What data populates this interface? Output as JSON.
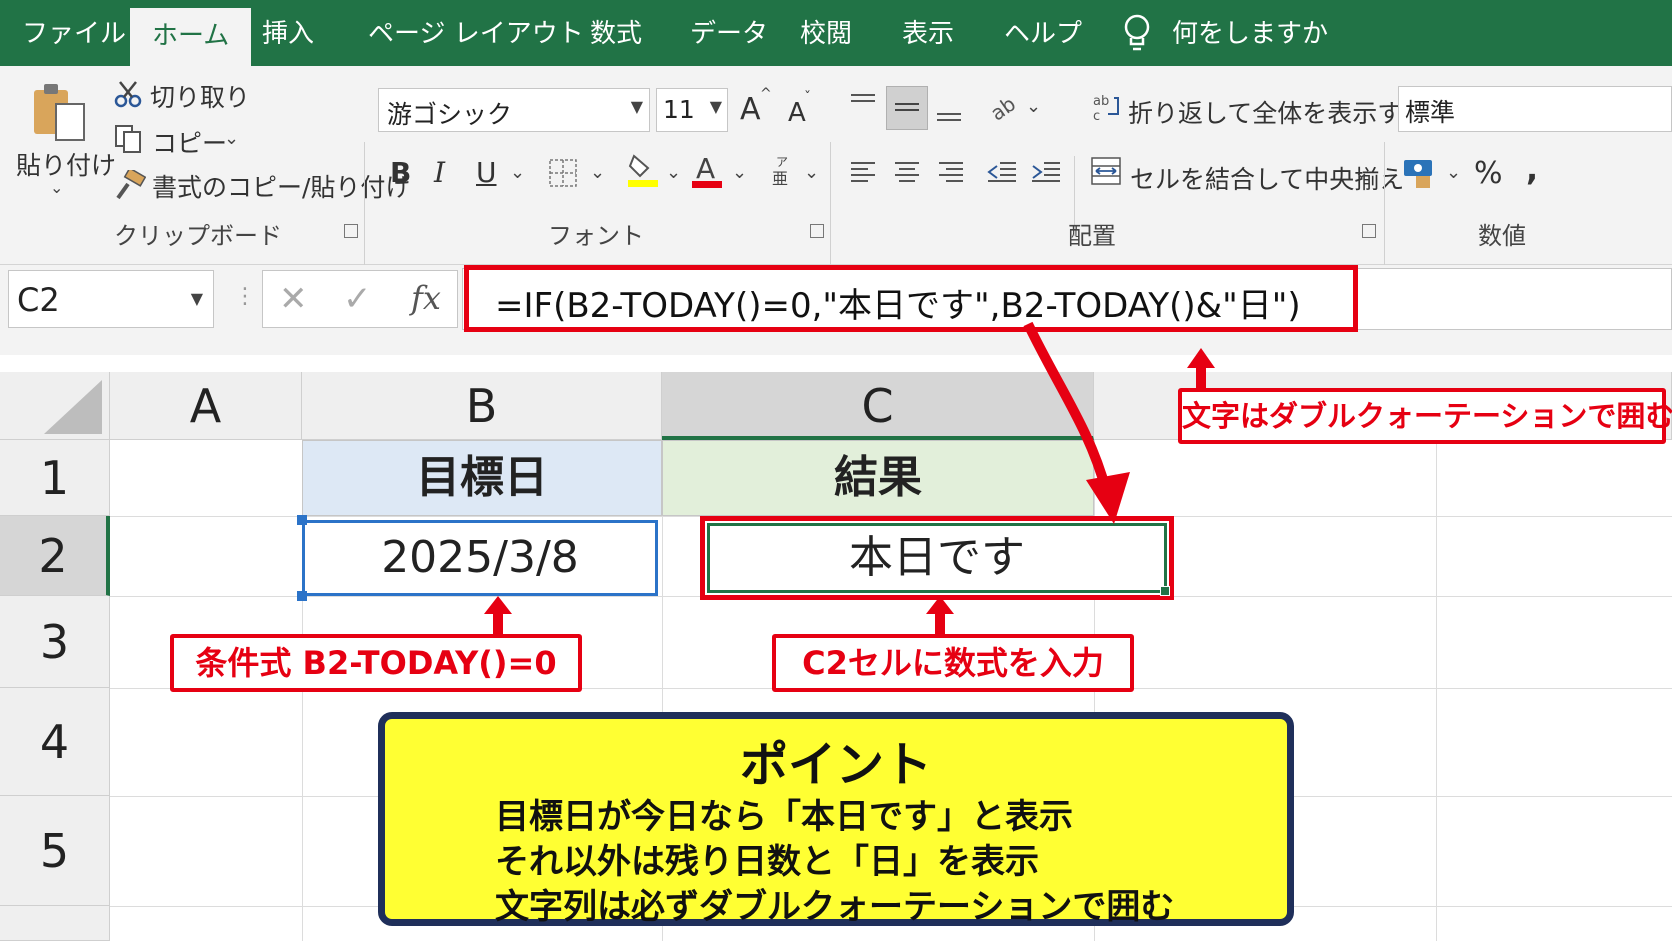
{
  "tabs": [
    "ファイル",
    "ホーム",
    "挿入",
    "ページ レイアウト",
    "数式",
    "データ",
    "校閲",
    "表示",
    "ヘルプ"
  ],
  "active_tab": "ホーム",
  "tell_me": "何をしますか",
  "clipboard": {
    "paste": "貼り付け",
    "cut": "切り取り",
    "copy": "コピー",
    "format_painter": "書式のコピー/貼り付け",
    "group": "クリップボード"
  },
  "font": {
    "name": "游ゴシック",
    "size": "11",
    "grow": "A",
    "shrink": "A",
    "bold": "B",
    "italic": "I",
    "underline": "U",
    "group": "フォント"
  },
  "alignment": {
    "wrap_text": "折り返して全体を表示する",
    "merge_center": "セルを結合して中央揃え",
    "group": "配置"
  },
  "number": {
    "format": "標準",
    "percent": "%",
    "comma": ",",
    "group": "数値"
  },
  "formula_bar": {
    "name_box": "C2",
    "fx": "fx",
    "formula": "=IF(B2-TODAY()=0,\"本日です\",B2-TODAY()&\"日\")"
  },
  "grid": {
    "columns": [
      "A",
      "B",
      "C"
    ],
    "rows": [
      "1",
      "2",
      "3",
      "4",
      "5"
    ],
    "cells": {
      "B1": "目標日",
      "C1": "結果",
      "B2": "2025/3/8",
      "C2": "本日です"
    }
  },
  "callouts": {
    "quote_note": "文字はダブルクォーテーションで囲む",
    "condition_note": "条件式 B2-TODAY()=0",
    "input_note": "C2セルに数式を入力"
  },
  "point_box": {
    "title": "ポイント",
    "lines": [
      "目標日が今日なら「本日です」と表示",
      "それ以外は残り日数と「日」を表示",
      "文字列は必ずダブルクォーテーションで囲む"
    ]
  },
  "colors": {
    "excel_green": "#217346",
    "callout_red": "#e60012",
    "header_b_fill": "#dde8f5",
    "header_c_fill": "#e2efda",
    "point_fill": "#ffff33",
    "point_border": "#1f2f5a"
  }
}
